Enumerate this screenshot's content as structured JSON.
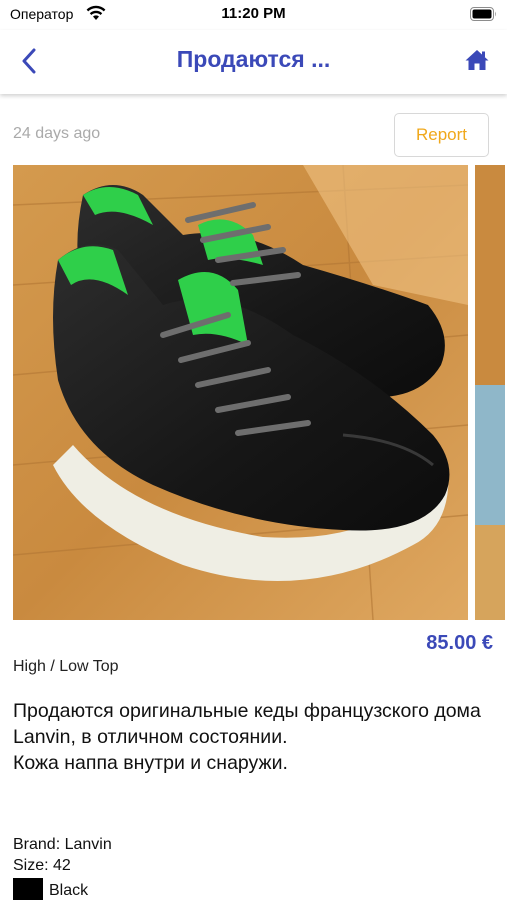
{
  "status_bar": {
    "carrier": "Оператор",
    "time": "11:20 PM"
  },
  "nav": {
    "title": "Продаются ...",
    "back_icon": "chevron-left-icon",
    "home_icon": "home-icon",
    "accent_color": "#3b49b8"
  },
  "listing": {
    "posted_ago": "24 days ago",
    "report_label": "Report",
    "price": "85.00 €",
    "category": "High / Low Top",
    "description": "Продаются оригинальные кеды французского дома Lanvin, в отличном состоянии.\nКожа наппа внутри и снаружи.",
    "brand": "Brand: Lanvin",
    "size": "Size: 42",
    "color_name": "Black",
    "color_hex": "#000000"
  }
}
